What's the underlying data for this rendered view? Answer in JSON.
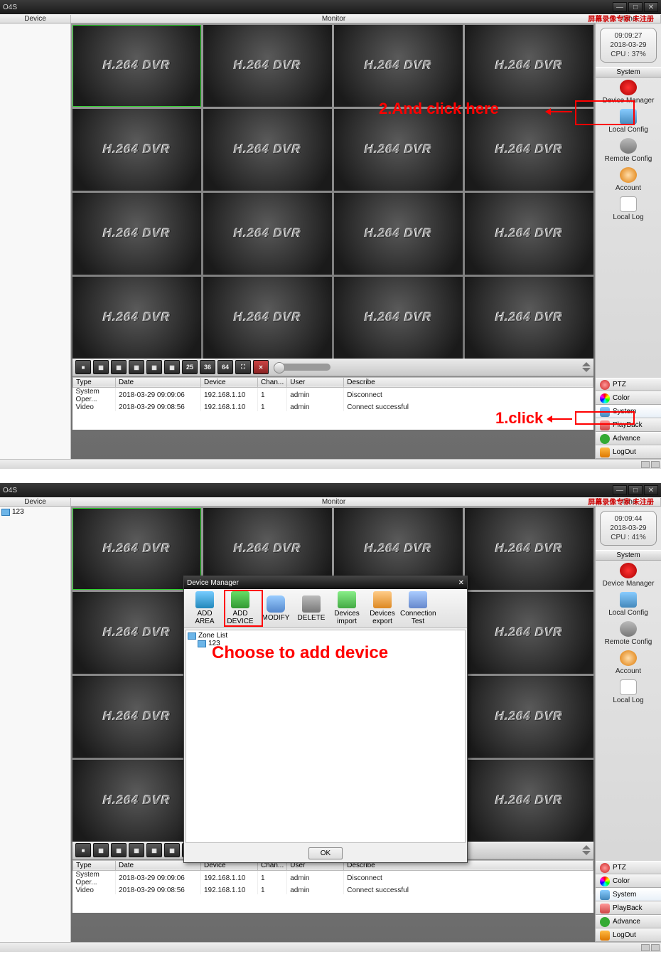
{
  "shot1": {
    "app_title": "O4S",
    "watermark": "屏幕录像专家 未注册",
    "header": {
      "device": "Device",
      "monitor": "Monitor",
      "time": "Time"
    },
    "clock": {
      "time": "09:09:27",
      "date": "2018-03-29",
      "cpu": "CPU : 37%"
    },
    "system_head": "System",
    "system_items": [
      {
        "label": "Device Manager"
      },
      {
        "label": "Local Config"
      },
      {
        "label": "Remote Config"
      },
      {
        "label": "Account"
      },
      {
        "label": "Local Log"
      }
    ],
    "right_buttons": [
      {
        "label": "PTZ"
      },
      {
        "label": "Color"
      },
      {
        "label": "System"
      },
      {
        "label": "PlayBack"
      },
      {
        "label": "Advance"
      },
      {
        "label": "LogOut"
      }
    ],
    "cell_text": "H.264 DVR",
    "toolbar_nums": [
      "25",
      "36",
      "64"
    ],
    "log_headers": [
      "Type",
      "Date",
      "Device",
      "Chan...",
      "User",
      "Describe"
    ],
    "log_rows": [
      {
        "type": "System Oper...",
        "date": "2018-03-29 09:09:06",
        "device": "192.168.1.10",
        "chan": "1",
        "user": "admin",
        "desc": "Disconnect"
      },
      {
        "type": "Video",
        "date": "2018-03-29 09:08:56",
        "device": "192.168.1.10",
        "chan": "1",
        "user": "admin",
        "desc": "Connect successful"
      }
    ],
    "anno1": {
      "text": "1.click"
    },
    "anno2": {
      "text": "2.And click here"
    }
  },
  "shot2": {
    "app_title": "O4S",
    "tree_item": "123",
    "clock": {
      "time": "09:09:44",
      "date": "2018-03-29",
      "cpu": "CPU : 41%"
    },
    "system_head": "System",
    "dialog": {
      "title": "Device Manager",
      "buttons": [
        {
          "label": "ADD AREA"
        },
        {
          "label": "ADD DEVICE"
        },
        {
          "label": "MODIFY"
        },
        {
          "label": "DELETE"
        },
        {
          "label": "Devices import"
        },
        {
          "label": "Devices export"
        },
        {
          "label": "Connection Test"
        }
      ],
      "zone_list_label": "Zone List",
      "zone_items": [
        "123"
      ],
      "ok": "OK",
      "anno": "Choose to add device"
    }
  }
}
